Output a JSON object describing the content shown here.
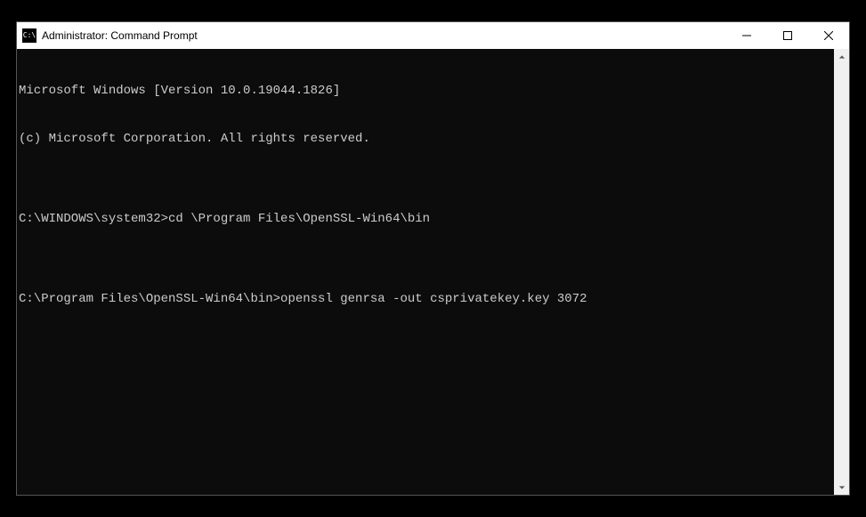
{
  "window": {
    "title": "Administrator: Command Prompt",
    "icon_label": "cmd-icon"
  },
  "terminal": {
    "lines": [
      "Microsoft Windows [Version 10.0.19044.1826]",
      "(c) Microsoft Corporation. All rights reserved.",
      "",
      "C:\\WINDOWS\\system32>cd \\Program Files\\OpenSSL-Win64\\bin",
      "",
      "C:\\Program Files\\OpenSSL-Win64\\bin>openssl genrsa -out csprivatekey.key 3072"
    ]
  }
}
